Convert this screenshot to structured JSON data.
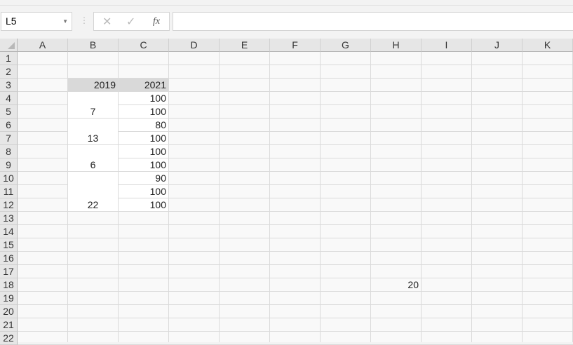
{
  "name_box": {
    "value": "L5"
  },
  "formula_bar": {
    "cancel_icon": "✕",
    "enter_icon": "✓",
    "fx_label": "fx",
    "value": ""
  },
  "columns": [
    "A",
    "B",
    "C",
    "D",
    "E",
    "F",
    "G",
    "H",
    "I",
    "J",
    "K"
  ],
  "rows": [
    "1",
    "2",
    "3",
    "4",
    "5",
    "6",
    "7",
    "8",
    "9",
    "10",
    "11",
    "12",
    "13",
    "14",
    "15",
    "16",
    "17",
    "18",
    "19",
    "20",
    "21",
    "22"
  ],
  "cells": [
    {
      "ref": "B3",
      "value": "2019",
      "align": "right",
      "fill": "#d9d9d9"
    },
    {
      "ref": "C3",
      "value": "2021",
      "align": "right",
      "fill": "#d9d9d9"
    },
    {
      "ref": "B4:B5",
      "value": "7",
      "align": "center",
      "fill": "#ffffff"
    },
    {
      "ref": "B6:B7",
      "value": "13",
      "align": "center",
      "fill": "#ffffff"
    },
    {
      "ref": "B8:B9",
      "value": "6",
      "align": "center",
      "fill": "#ffffff"
    },
    {
      "ref": "B10:B12",
      "value": "22",
      "align": "center",
      "fill": "#ffffff"
    },
    {
      "ref": "C4",
      "value": "100",
      "align": "right",
      "fill": "#ffffff"
    },
    {
      "ref": "C5",
      "value": "100",
      "align": "right",
      "fill": "#ffffff"
    },
    {
      "ref": "C6",
      "value": "80",
      "align": "right",
      "fill": "#ffffff"
    },
    {
      "ref": "C7",
      "value": "100",
      "align": "right",
      "fill": "#ffffff"
    },
    {
      "ref": "C8",
      "value": "100",
      "align": "right",
      "fill": "#ffffff"
    },
    {
      "ref": "C9",
      "value": "100",
      "align": "right",
      "fill": "#ffffff"
    },
    {
      "ref": "C10",
      "value": "90",
      "align": "right",
      "fill": "#ffffff"
    },
    {
      "ref": "C11",
      "value": "100",
      "align": "right",
      "fill": "#ffffff"
    },
    {
      "ref": "C12",
      "value": "100",
      "align": "right",
      "fill": "#ffffff"
    },
    {
      "ref": "H18",
      "value": "20",
      "align": "right",
      "fill": ""
    }
  ]
}
